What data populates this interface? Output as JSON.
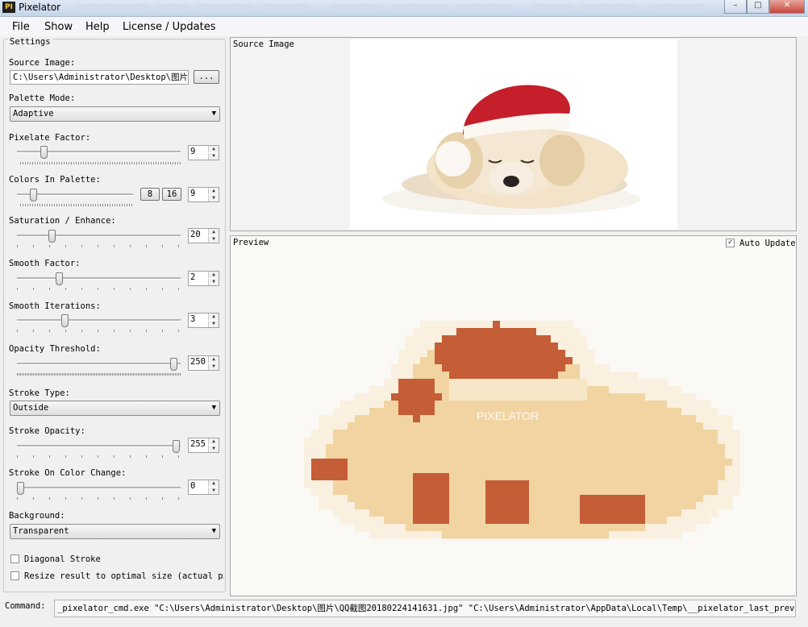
{
  "window": {
    "title": "Pixelator",
    "icon": "pixelator-app-icon",
    "close_glyph": "✕",
    "minimize_glyph": "–",
    "maximize_glyph": "□"
  },
  "menu": [
    "File",
    "Show",
    "Help",
    "License / Updates"
  ],
  "settings": {
    "title": "Settings",
    "source_image": {
      "label": "Source Image:",
      "value": "C:\\Users\\Administrator\\Desktop\\图片\\",
      "browse_label": "..."
    },
    "palette_mode": {
      "label": "Palette Mode:",
      "value": "Adaptive"
    },
    "pixelate_factor": {
      "label": "Pixelate Factor:",
      "value": "9"
    },
    "colors_in_palette": {
      "label": "Colors In Palette:",
      "value": "9",
      "btn8": "8",
      "btn16": "16"
    },
    "saturation": {
      "label": "Saturation / Enhance:",
      "value": "20"
    },
    "smooth_factor": {
      "label": "Smooth Factor:",
      "value": "2"
    },
    "smooth_iterations": {
      "label": "Smooth Iterations:",
      "value": "3"
    },
    "opacity_threshold": {
      "label": "Opacity Threshold:",
      "value": "250"
    },
    "stroke_type": {
      "label": "Stroke Type:",
      "value": "Outside"
    },
    "stroke_opacity": {
      "label": "Stroke Opacity:",
      "value": "255"
    },
    "stroke_on_color_change": {
      "label": "Stroke On Color Change:",
      "value": "0"
    },
    "background": {
      "label": "Background:",
      "value": "Transparent"
    },
    "diagonal_stroke": {
      "label": "Diagonal Stroke",
      "checked": false
    },
    "resize_result": {
      "label": "Resize result to optimal size (actual pix",
      "checked": false
    }
  },
  "source_panel": {
    "title": "Source Image"
  },
  "preview_panel": {
    "title": "Preview",
    "auto_update_label": "Auto Update",
    "auto_update_checked": true,
    "watermark": "PIXELATOR"
  },
  "command": {
    "label": "Command:",
    "value": "_pixelator_cmd.exe \"C:\\Users\\Administrator\\Desktop\\图片\\QQ截图20180224141631.jpg\" \"C:\\Users\\Administrator\\AppData\\Local\\Temp\\__pixelator_last_preview.png\""
  },
  "colors": {
    "hat_red": "#c55d37",
    "fur": "#f1d4a2",
    "fur_light": "#f7e6c8",
    "fur_pale": "#faf0e0"
  }
}
